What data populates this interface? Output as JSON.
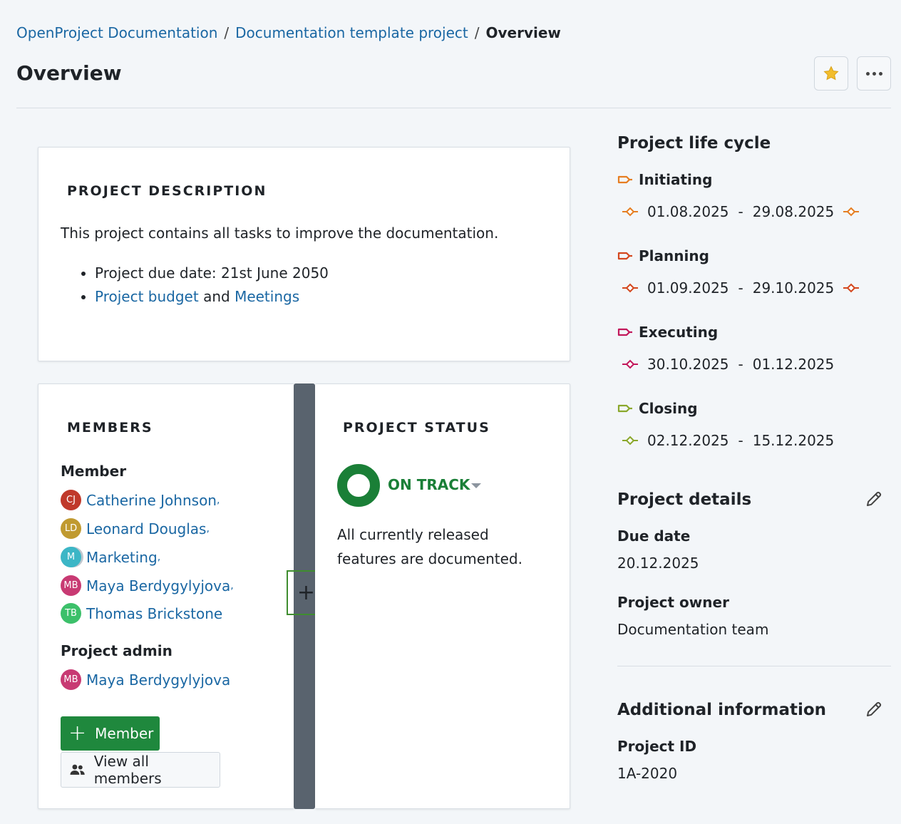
{
  "breadcrumb": {
    "items": [
      "OpenProject Documentation",
      "Documentation template project"
    ],
    "current": "Overview"
  },
  "page_title": "Overview",
  "header_actions": {
    "favorite_icon": "star-icon",
    "more_icon": "more-icon",
    "favorite_color": "#f2bd2c"
  },
  "description_widget": {
    "title": "PROJECT DESCRIPTION",
    "text": "This project contains all tasks to improve the documentation.",
    "bullet_1": "Project due date: 21st June 2050",
    "bullet_2_link_1": "Project budget",
    "bullet_2_and": "and",
    "bullet_2_link_2": "Meetings"
  },
  "members_widget": {
    "title": "MEMBERS",
    "role_member": "Member",
    "members": [
      {
        "initials": "CJ",
        "name": "Catherine Johnson",
        "color": "#c0392b"
      },
      {
        "initials": "LD",
        "name": "Leonard Douglas",
        "color": "#c09a30"
      },
      {
        "initials": "M",
        "name": "Marketing",
        "color": "#3cb6c6"
      },
      {
        "initials": "MB",
        "name": "Maya Berdygylyjova",
        "color": "#c83a73"
      },
      {
        "initials": "TB",
        "name": "Thomas Brickstone",
        "color": "#3cc06a"
      }
    ],
    "role_admin": "Project admin",
    "admins": [
      {
        "initials": "MB",
        "name": "Maya Berdygylyjova",
        "color": "#c83a73"
      }
    ],
    "comma": ",",
    "add_member_label": "Member",
    "view_all_label": "View all members"
  },
  "status_widget": {
    "title": "PROJECT STATUS",
    "status": "ON TRACK",
    "status_color": "#1a7f37",
    "text": "All currently released features are documented."
  },
  "life_cycle": {
    "title": "Project life cycle",
    "phases": [
      {
        "name": "Initiating",
        "start": "01.08.2025",
        "end": "29.08.2025",
        "color": "#e67e22",
        "end_marker": true
      },
      {
        "name": "Planning",
        "start": "01.09.2025",
        "end": "29.10.2025",
        "color": "#d4471e",
        "end_marker": true
      },
      {
        "name": "Executing",
        "start": "30.10.2025",
        "end": "01.12.2025",
        "color": "#c2185b",
        "end_marker": false
      },
      {
        "name": "Closing",
        "start": "02.12.2025",
        "end": "15.12.2025",
        "color": "#8aa82c",
        "end_marker": false
      }
    ],
    "dash": "-"
  },
  "project_details": {
    "title": "Project details",
    "due_date_label": "Due date",
    "due_date": "20.12.2025",
    "owner_label": "Project owner",
    "owner": "Documentation team"
  },
  "additional_info": {
    "title": "Additional information",
    "project_id_label": "Project ID",
    "project_id": "1A-2020"
  }
}
